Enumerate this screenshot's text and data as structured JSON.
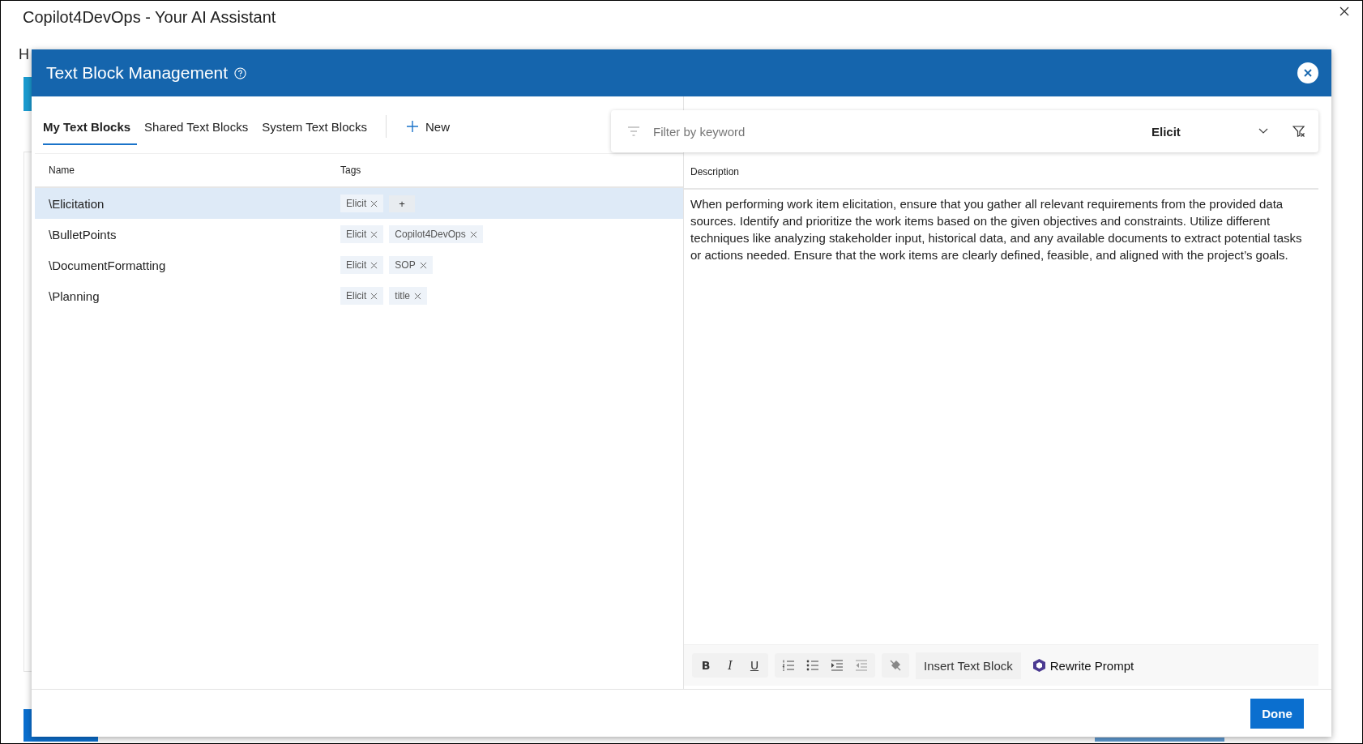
{
  "window": {
    "title": "Copilot4DevOps - Your AI Assistant"
  },
  "background": {
    "heading": "H"
  },
  "dialog": {
    "title": "Text Block Management",
    "tabs": [
      {
        "label": "My Text Blocks",
        "selected": true
      },
      {
        "label": "Shared Text Blocks",
        "selected": false
      },
      {
        "label": "System Text Blocks",
        "selected": false
      }
    ],
    "new_button": "New",
    "filter": {
      "placeholder": "Filter by keyword",
      "tag": "Elicit"
    },
    "table": {
      "columns": [
        "Name",
        "Tags"
      ],
      "rows": [
        {
          "name": "\\Elicitation",
          "selected": true,
          "tags": [
            "Elicit"
          ],
          "add_tag": "+"
        },
        {
          "name": "\\BulletPoints",
          "selected": false,
          "tags": [
            "Elicit",
            "Copilot4DevOps"
          ]
        },
        {
          "name": "\\DocumentFormatting",
          "selected": false,
          "tags": [
            "Elicit",
            "SOP"
          ]
        },
        {
          "name": "\\Planning",
          "selected": false,
          "tags": [
            "Elicit",
            "title"
          ]
        }
      ]
    },
    "description": {
      "heading": "Description",
      "text": "When performing work item elicitation, ensure that you gather all relevant requirements from the provided data sources. Identify and prioritize the work items based on the given objectives and constraints. Utilize different techniques like analyzing stakeholder input, historical data, and any available documents to extract potential tasks or actions needed. Ensure that the work items are clearly defined, feasible, and aligned with the project’s goals."
    },
    "toolbar": {
      "format_buttons": [
        {
          "kind": "bold",
          "label": "B"
        },
        {
          "kind": "italic",
          "label": "I"
        },
        {
          "kind": "underline",
          "label": "U"
        }
      ],
      "insert_button": "Insert Text Block",
      "rewrite_button": "Rewrite Prompt"
    },
    "done_button": "Done"
  }
}
